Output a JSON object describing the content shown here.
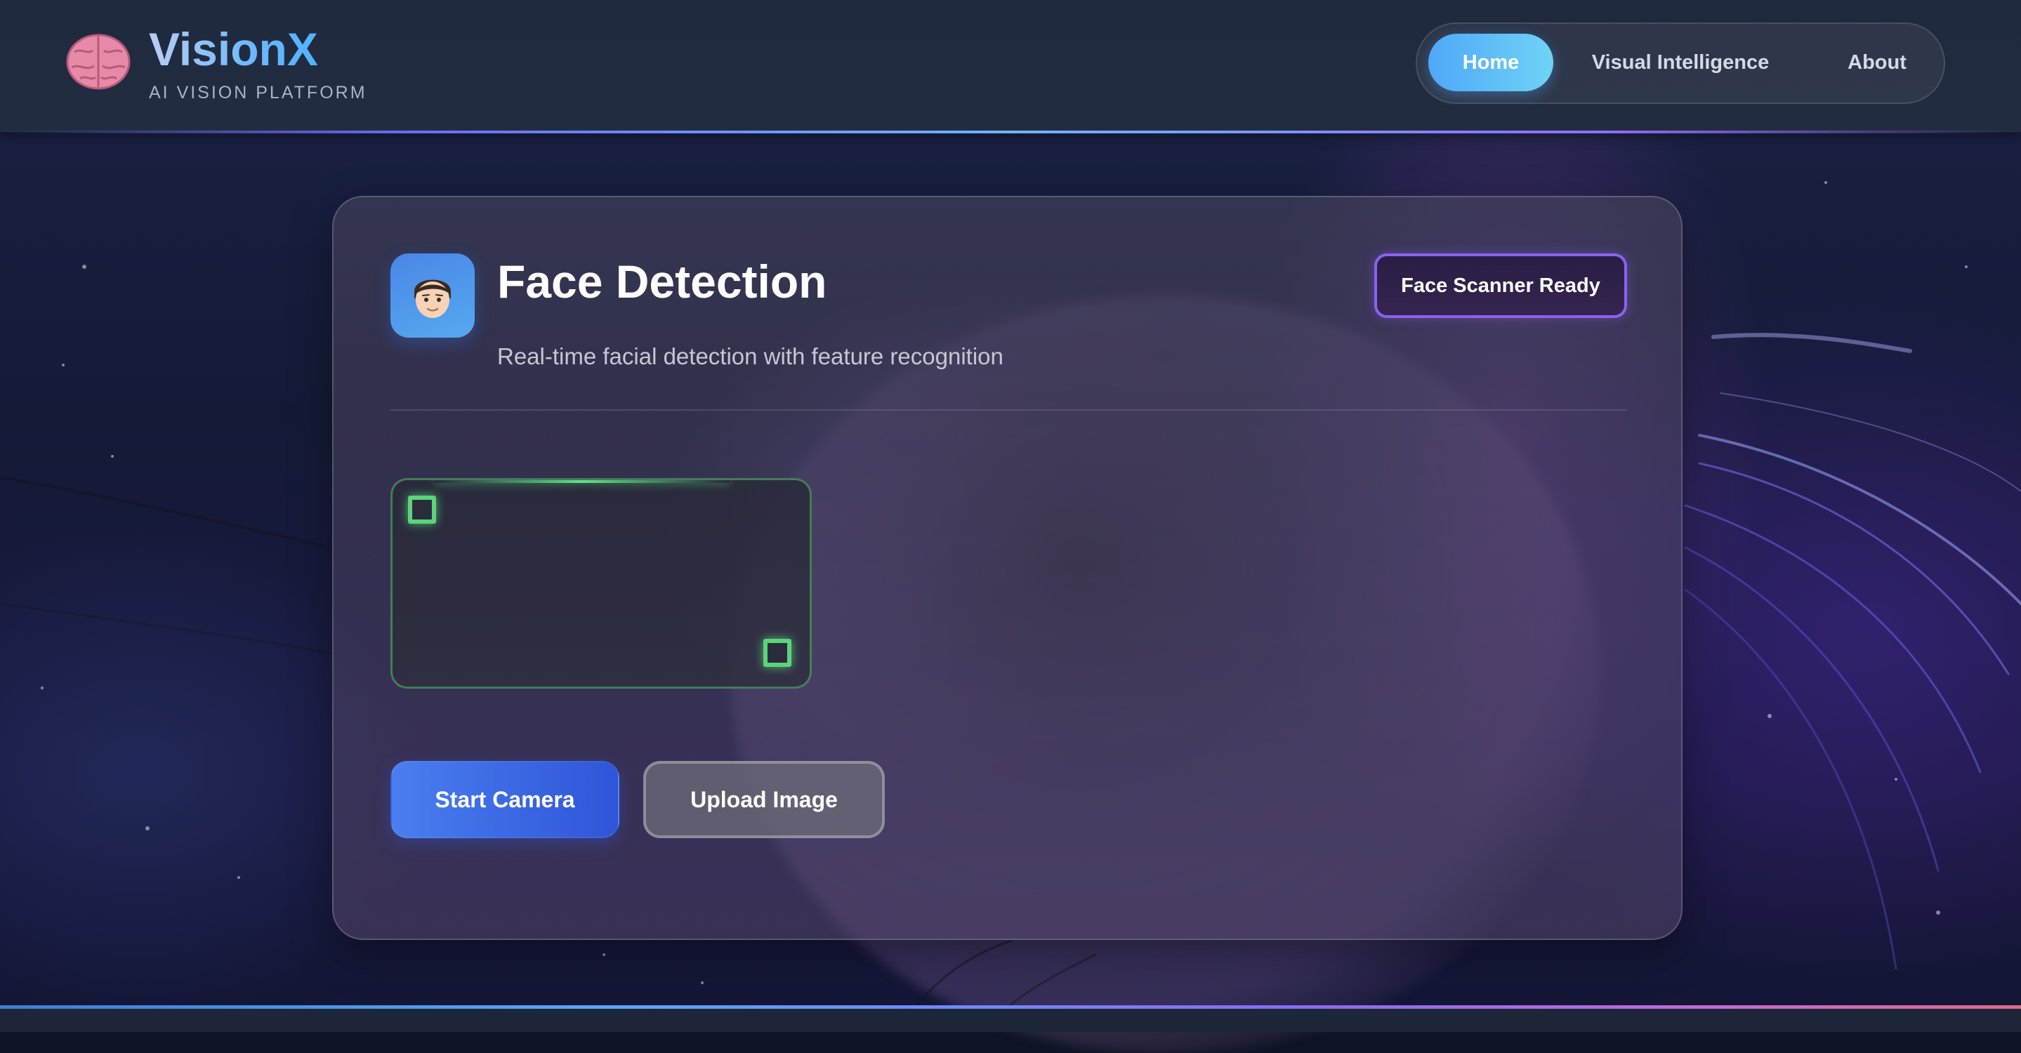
{
  "brand": {
    "name": "VisionX",
    "tagline": "AI VISION PLATFORM",
    "icon": "brain-icon"
  },
  "nav": {
    "items": [
      {
        "label": "Home",
        "active": true
      },
      {
        "label": "Visual Intelligence",
        "active": false
      },
      {
        "label": "About",
        "active": false
      }
    ]
  },
  "feature": {
    "icon": "face-icon",
    "title": "Face Detection",
    "description": "Real-time facial detection with feature recognition",
    "status": "Face Scanner Ready"
  },
  "actions": {
    "start_camera": "Start Camera",
    "upload_image": "Upload Image"
  },
  "colors": {
    "accent_blue": "#4a7ef0",
    "nav_active": "#5bbcf7",
    "status_border": "#8a62f0",
    "scanner_green": "#5bd47a"
  }
}
